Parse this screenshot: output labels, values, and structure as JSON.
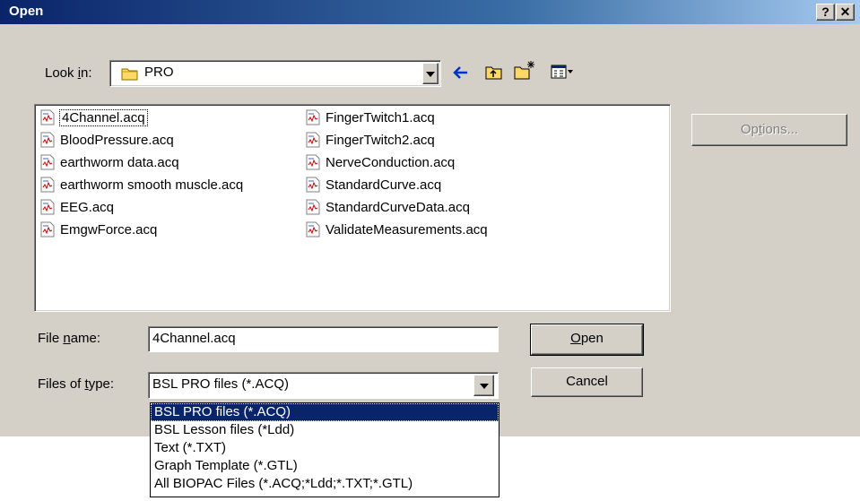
{
  "window": {
    "title": "Open",
    "help_label": "?",
    "close_label": "✕"
  },
  "look_in": {
    "label_pre": "Look ",
    "label_u": "i",
    "label_post": "n:",
    "value": "PRO",
    "folder_icon": "folder-icon"
  },
  "toolbar": {
    "icons": [
      "back-arrow-icon",
      "up-folder-icon",
      "new-folder-icon",
      "view-menu-icon"
    ]
  },
  "files": [
    {
      "name": "4Channel.acq",
      "selected": true
    },
    {
      "name": "BloodPressure.acq"
    },
    {
      "name": "earthworm data.acq"
    },
    {
      "name": "earthworm smooth muscle.acq"
    },
    {
      "name": "EEG.acq"
    },
    {
      "name": "EmgwForce.acq"
    },
    {
      "name": "FingerTwitch1.acq"
    },
    {
      "name": "FingerTwitch2.acq"
    },
    {
      "name": "NerveConduction.acq"
    },
    {
      "name": "StandardCurve.acq"
    },
    {
      "name": "StandardCurveData.acq"
    },
    {
      "name": "ValidateMeasurements.acq"
    }
  ],
  "file_name": {
    "label_pre": "File ",
    "label_u": "n",
    "label_post": "ame:",
    "value": "4Channel.acq"
  },
  "file_type": {
    "label_pre": "Files of ",
    "label_u": "t",
    "label_post": "ype:",
    "value": "BSL PRO files (*.ACQ)",
    "options": [
      "BSL PRO files (*.ACQ)",
      "BSL Lesson files (*Ldd)",
      "Text (*.TXT)",
      "Graph Template (*.GTL)",
      "All BIOPAC Files (*.ACQ;*Ldd;*.TXT;*.GTL)"
    ]
  },
  "buttons": {
    "open_u": "O",
    "open_rest": "pen",
    "cancel": "Cancel",
    "options_pre": "Op",
    "options_u": "t",
    "options_post": "ions..."
  }
}
